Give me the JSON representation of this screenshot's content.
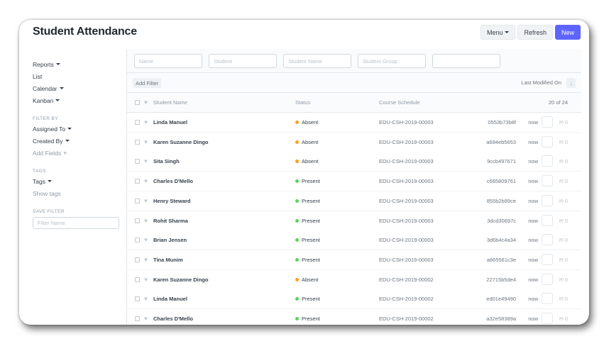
{
  "header": {
    "title": "Student Attendance",
    "menu_label": "Menu",
    "refresh_label": "Refresh",
    "new_label": "New",
    "accent": "#5e64ff"
  },
  "sidebar": {
    "items": [
      "Reports",
      "List",
      "Calendar",
      "Kanban"
    ],
    "filter_by_heading": "FILTER BY",
    "filters": [
      "Assigned To",
      "Created By"
    ],
    "add_fields": "Add Fields",
    "tags_heading": "TAGS",
    "tags": "Tags",
    "show_tags": "Show tags",
    "save_filter_heading": "SAVE FILTER",
    "filter_name_placeholder": "Filter Name"
  },
  "filters": {
    "placeholders": [
      "Name",
      "Student",
      "Student Name",
      "Student Group",
      ""
    ],
    "add_filter": "Add Filter",
    "sort_label": "Last Modified On",
    "sort_icon": "sort-descending-icon"
  },
  "list": {
    "columns": [
      "Student Name",
      "Status",
      "Course Schedule"
    ],
    "count": "20 of 24",
    "status_colors": {
      "Absent": "#ff9f1a",
      "Present": "#5ed15e"
    },
    "rows": [
      {
        "name": "Linda Manuel",
        "status": "Absent",
        "course": "EDU-CSH-2019-00003",
        "id": "0553b73b8f",
        "time": "now",
        "comments": "0"
      },
      {
        "name": "Karen Suzanne Dingo",
        "status": "Absent",
        "course": "EDU-CSH-2019-00003",
        "id": "a694eb5653",
        "time": "now",
        "comments": "0"
      },
      {
        "name": "Sita Singh",
        "status": "Absent",
        "course": "EDU-CSH-2019-00003",
        "id": "9ccb497671",
        "time": "now",
        "comments": "0"
      },
      {
        "name": "Charles D'Mello",
        "status": "Present",
        "course": "EDU-CSH-2019-00003",
        "id": "c665809761",
        "time": "now",
        "comments": "0"
      },
      {
        "name": "Henry Steward",
        "status": "Present",
        "course": "EDU-CSH-2019-00003",
        "id": "855b2b89ce",
        "time": "now",
        "comments": "0"
      },
      {
        "name": "Rohit Sharma",
        "status": "Present",
        "course": "EDU-CSH-2019-00003",
        "id": "3dcd30697c",
        "time": "now",
        "comments": "0"
      },
      {
        "name": "Brian Jensen",
        "status": "Present",
        "course": "EDU-CSH-2019-00003",
        "id": "3d6b4c4a34",
        "time": "now",
        "comments": "0"
      },
      {
        "name": "Tina Munim",
        "status": "Present",
        "course": "EDU-CSH-2019-00003",
        "id": "a865561c3e",
        "time": "now",
        "comments": "0"
      },
      {
        "name": "Karen Suzanne Dingo",
        "status": "Absent",
        "course": "EDU-CSH-2019-00002",
        "id": "22715b5de4",
        "time": "now",
        "comments": "0"
      },
      {
        "name": "Linda Manuel",
        "status": "Present",
        "course": "EDU-CSH-2019-00002",
        "id": "ed01e49490",
        "time": "now",
        "comments": "0"
      },
      {
        "name": "Charles D'Mello",
        "status": "Present",
        "course": "EDU-CSH-2019-00002",
        "id": "a32e58389a",
        "time": "now",
        "comments": "0"
      }
    ]
  }
}
